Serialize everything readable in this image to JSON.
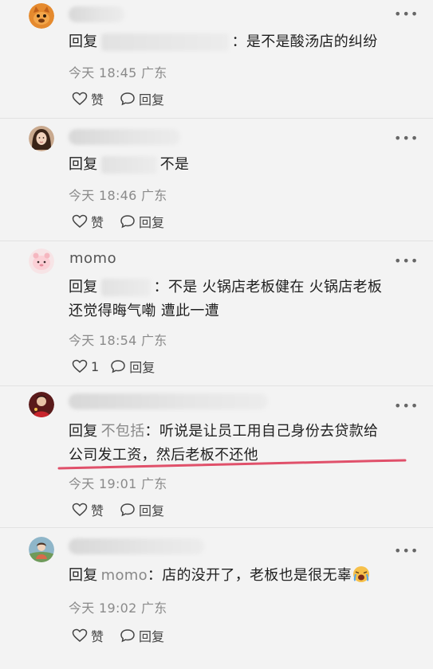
{
  "comments": [
    {
      "reply_word": "回复",
      "text": "：是不是酸汤店的纠纷",
      "time": "今天 18:45",
      "location": "广东",
      "like_label": "赞",
      "reply_label": "回复"
    },
    {
      "reply_word": "回复",
      "text": "不是",
      "time": "今天 18:46",
      "location": "广东",
      "like_label": "赞",
      "reply_label": "回复"
    },
    {
      "name": "momo",
      "reply_word": "回复",
      "text_line1": "：不是 火锅店老板健在 火锅店老板",
      "text_line2": "还觉得晦气嘞 遭此一遭",
      "time": "今天 18:54",
      "location": "广东",
      "like_count": "1",
      "reply_label": "回复"
    },
    {
      "reply_word": "回复",
      "target": "不包括",
      "text_line1": "：听说是让员工用自己身份去贷款给",
      "text_line2": "公司发工资，然后老板不还他",
      "time": "今天 19:01",
      "location": "广东",
      "like_label": "赞",
      "reply_label": "回复"
    },
    {
      "reply_word": "回复",
      "target": "momo",
      "text": "：店的没开了，老板也是很无辜",
      "time": "今天 19:02",
      "location": "广东",
      "like_label": "赞",
      "reply_label": "回复"
    }
  ],
  "colors": {
    "background": "#f3f3f3",
    "highlight": "#e0506a",
    "meta": "#8a8a8a"
  },
  "icons": [
    "more-icon",
    "heart-icon",
    "comment-icon",
    "emoji-icon"
  ]
}
